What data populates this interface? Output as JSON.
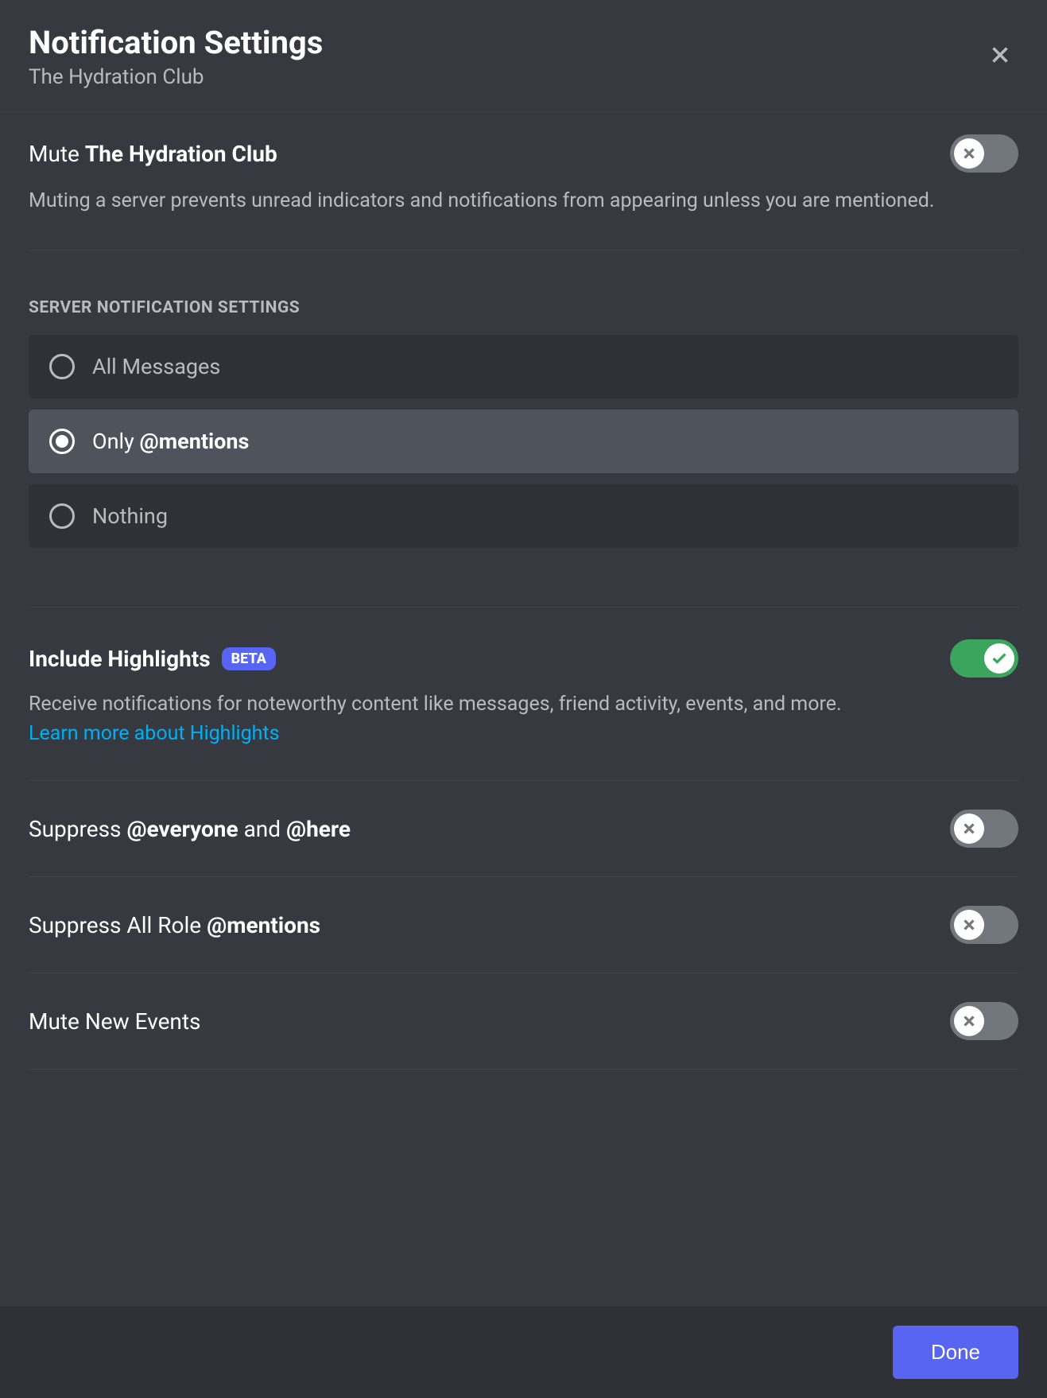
{
  "header": {
    "title": "Notification Settings",
    "subtitle": "The Hydration Club"
  },
  "mute": {
    "label_prefix": "Mute ",
    "label_bold": "The Hydration Club",
    "description": "Muting a server prevents unread indicators and notifications from appearing unless you are mentioned.",
    "enabled": false
  },
  "server_settings": {
    "heading": "SERVER NOTIFICATION SETTINGS",
    "options": [
      {
        "label_prefix": "",
        "label_normal": "All Messages",
        "label_bold": "",
        "selected": false
      },
      {
        "label_prefix": "Only ",
        "label_bold": "@mentions",
        "label_normal": "",
        "selected": true
      },
      {
        "label_prefix": "",
        "label_normal": "Nothing",
        "label_bold": "",
        "selected": false
      }
    ]
  },
  "highlights": {
    "title": "Include Highlights",
    "badge": "BETA",
    "description": "Receive notifications for noteworthy content like messages, friend activity, events, and more.",
    "learn_more": "Learn more about Highlights",
    "enabled": true
  },
  "suppress_everyone": {
    "label_prefix": "Suppress ",
    "label_bold_1": "@everyone",
    "label_mid": " and ",
    "label_bold_2": "@here",
    "enabled": false
  },
  "suppress_roles": {
    "label_prefix": "Suppress All Role ",
    "label_bold": "@mentions",
    "enabled": false
  },
  "mute_events": {
    "label": "Mute New Events",
    "enabled": false
  },
  "footer": {
    "done": "Done"
  }
}
